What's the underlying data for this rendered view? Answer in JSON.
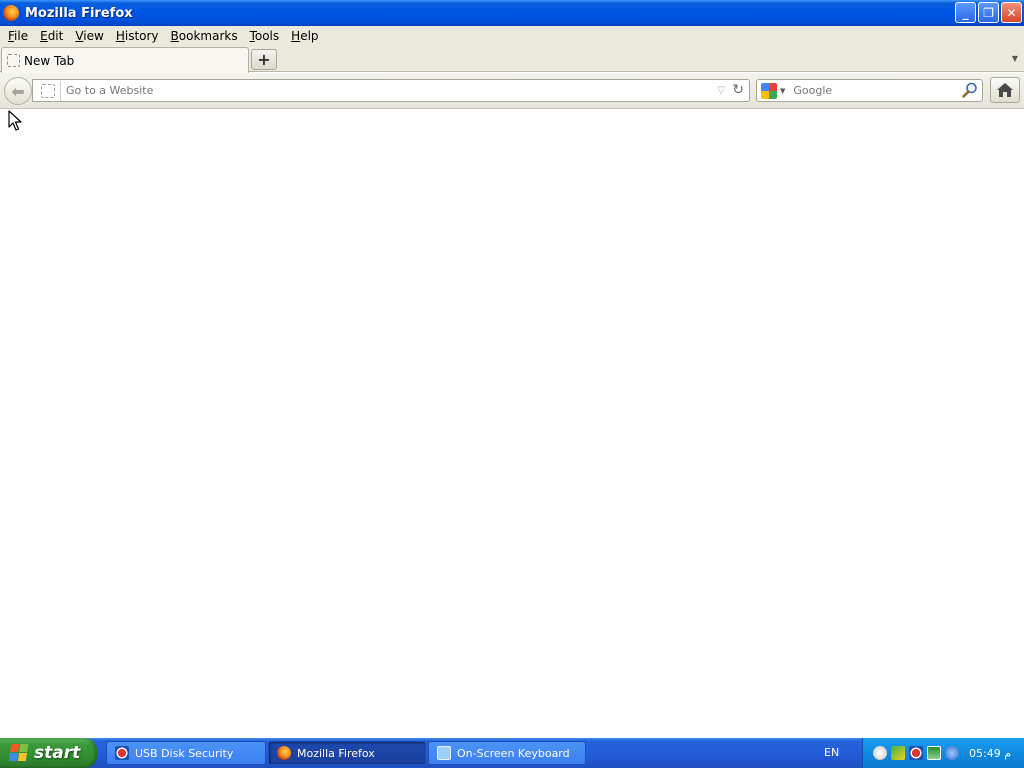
{
  "window": {
    "title": "Mozilla Firefox",
    "minimize_glyph": "_",
    "restore_glyph": "❐",
    "close_glyph": "✕"
  },
  "menu": {
    "items": [
      {
        "accel": "F",
        "rest": "ile"
      },
      {
        "accel": "E",
        "rest": "dit"
      },
      {
        "accel": "V",
        "rest": "iew"
      },
      {
        "accel": "H",
        "rest": "istory"
      },
      {
        "accel": "B",
        "rest": "ookmarks"
      },
      {
        "accel": "T",
        "rest": "ools"
      },
      {
        "accel": "H",
        "rest": "elp"
      }
    ]
  },
  "tabs": {
    "items": [
      {
        "label": "New Tab"
      }
    ],
    "new_tab_glyph": "+",
    "list_arrow_glyph": "▼"
  },
  "navbar": {
    "back_glyph": "⬅",
    "url_placeholder": "Go to a Website",
    "url_value": "",
    "dropmarker_glyph": "▽",
    "reload_glyph": "↻",
    "search_placeholder": "Google",
    "search_engine_drop_glyph": "▼"
  },
  "taskbar": {
    "start_label": "start",
    "tasks": [
      {
        "label": "USB Disk Security",
        "icon": "usb-icon",
        "active": false
      },
      {
        "label": "Mozilla Firefox",
        "icon": "firefox-icon",
        "active": true
      },
      {
        "label": "On-Screen Keyboard",
        "icon": "keyboard-icon",
        "active": false
      }
    ],
    "language": "EN",
    "clock": "05:49 م"
  },
  "colors": {
    "titlebar": "#0054e3",
    "chrome": "#ebe9dc",
    "taskbar": "#245edb",
    "start": "#3c9a3c",
    "tray": "#0f8ae0"
  }
}
